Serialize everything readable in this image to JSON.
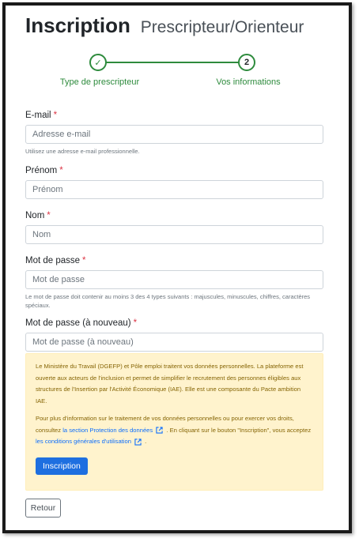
{
  "header": {
    "title": "Inscription",
    "subtitle": "Prescripteur/Orienteur"
  },
  "stepper": {
    "step1": {
      "symbol": "✓",
      "label": "Type de prescripteur"
    },
    "step2": {
      "symbol": "2",
      "label": "Vos informations"
    }
  },
  "form": {
    "email": {
      "label": "E-mail",
      "required": "*",
      "placeholder": "Adresse e-mail",
      "help": "Utilisez une adresse e-mail professionnelle."
    },
    "firstname": {
      "label": "Prénom",
      "required": "*",
      "placeholder": "Prénom"
    },
    "lastname": {
      "label": "Nom",
      "required": "*",
      "placeholder": "Nom"
    },
    "password": {
      "label": "Mot de passe",
      "required": "*",
      "placeholder": "Mot de passe",
      "help": "Le mot de passe doit contenir au moins 3 des 4 types suivants : majuscules, minuscules, chiffres, caractères spéciaux."
    },
    "password2": {
      "label": "Mot de passe (à nouveau)",
      "required": "*",
      "placeholder": "Mot de passe (à nouveau)"
    }
  },
  "notice": {
    "para1": "Le Ministère du Travail (DGEFP) et Pôle emploi traitent vos données personnelles. La plateforme est ouverte aux acteurs de l'inclusion et permet de simplifier le recrutement des personnes éligibles aux structures de l'Insertion par l'Activité Économique (IAE). Elle est une composante du Pacte ambition IAE.",
    "para2_a": "Pour plus d'information sur le traitement de vos données personnelles ou pour exercer vos droits, consultez",
    "link1": "la section Protection des données",
    "para2_b": ". En cliquant sur le bouton \"Inscription\", vous acceptez",
    "link2": "les conditions générales d'utilisation",
    "para2_c": "."
  },
  "buttons": {
    "submit": "Inscription",
    "back": "Retour"
  },
  "colors": {
    "accent_green": "#2e8b3d",
    "primary_blue": "#1e6fe0",
    "notice_bg": "#fff3cd",
    "required_red": "#dc3545"
  },
  "icons": {
    "external_link": "external-link-icon",
    "check": "check-icon"
  }
}
